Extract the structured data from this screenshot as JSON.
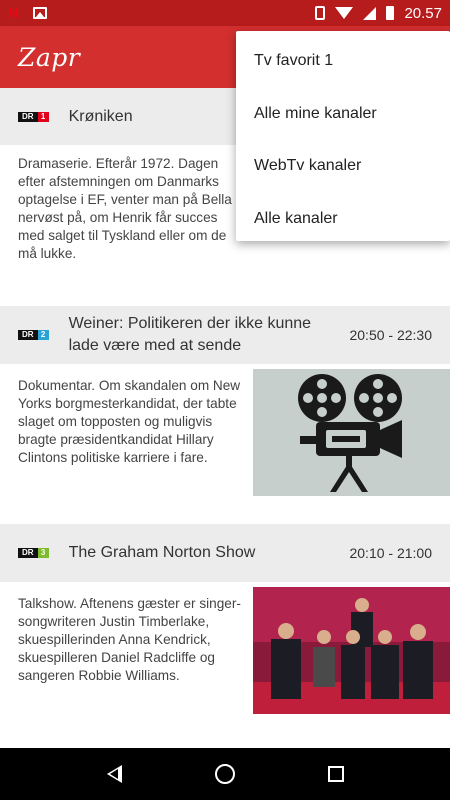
{
  "status_bar": {
    "time": "20.57"
  },
  "app_bar": {
    "title": "Zapr"
  },
  "menu": {
    "items": [
      "Tv favorit 1",
      "Alle mine kanaler",
      "WebTv kanaler",
      "Alle kanaler"
    ]
  },
  "programs": [
    {
      "channel_badge": "DR",
      "channel_number": "1",
      "channel_color": "#e3001b",
      "title": "Krøniken",
      "time": "",
      "description": "Dramaserie. Efterår 1972. Dagen efter afstemningen om Danmarks optagelse i EF, venter man på Bella nervøst på, om Henrik får succes med salget til Tyskland eller om de må lukke."
    },
    {
      "channel_badge": "DR",
      "channel_number": "2",
      "channel_color": "#29a3d8",
      "title": "Weiner: Politikeren der ikke kunne lade være med at sende",
      "time": "20:50 - 22:30",
      "description": "Dokumentar. Om skandalen om New Yorks borgmesterkandidat, der tabte slaget om topposten og muligvis bragte præsidentkandidat Hillary Clintons politiske karriere i fare."
    },
    {
      "channel_badge": "DR",
      "channel_number": "3",
      "channel_color": "#7dbd2b",
      "title": "The Graham Norton Show",
      "time": "20:10 - 21:00",
      "description": "Talkshow. Aftenens gæster er singer-songwriteren Justin Timberlake, skuespillerinden Anna Kendrick, skuespilleren Daniel Radcliffe og sangeren Robbie Williams."
    }
  ],
  "colors": {
    "app_bar": "#d32f2f",
    "status_bar": "#b71c1c",
    "header_bg": "#ececec"
  },
  "icons": [
    "netflix-icon",
    "gallery-icon",
    "vibrate-icon",
    "wifi-icon",
    "signal-icon",
    "battery-icon",
    "film-projector-icon",
    "back-icon",
    "home-icon",
    "recents-icon"
  ]
}
